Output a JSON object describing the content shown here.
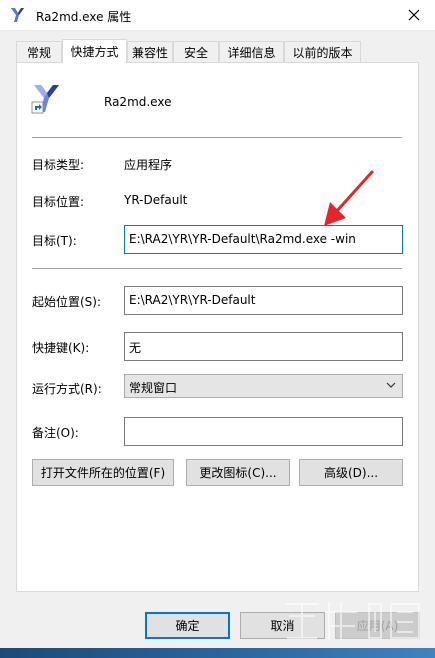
{
  "window": {
    "title": "Ra2md.exe 属性",
    "close_icon": "close-icon"
  },
  "tabs": [
    {
      "label": "常规"
    },
    {
      "label": "快捷方式",
      "active": true
    },
    {
      "label": "兼容性"
    },
    {
      "label": "安全"
    },
    {
      "label": "详细信息"
    },
    {
      "label": "以前的版本"
    }
  ],
  "shortcut": {
    "app_name": "Ra2md.exe",
    "target_type_label": "目标类型:",
    "target_type_value": "应用程序",
    "target_location_label": "目标位置:",
    "target_location_value": "YR-Default",
    "target_label": "目标(T):",
    "target_value": "E:\\RA2\\YR\\YR-Default\\Ra2md.exe -win",
    "start_in_label": "起始位置(S):",
    "start_in_value": "E:\\RA2\\YR\\YR-Default",
    "hotkey_label": "快捷键(K):",
    "hotkey_value": "无",
    "run_label": "运行方式(R):",
    "run_value": "常规窗口",
    "comment_label": "备注(O):",
    "comment_value": ""
  },
  "actions": {
    "open_location": "打开文件所在的位置(F)",
    "change_icon": "更改图标(C)...",
    "advanced": "高级(D)..."
  },
  "footer": {
    "ok": "确定",
    "cancel": "取消",
    "apply": "应用(A)"
  },
  "colors": {
    "accent": "#0078d7",
    "arrow": "#e3262b"
  }
}
